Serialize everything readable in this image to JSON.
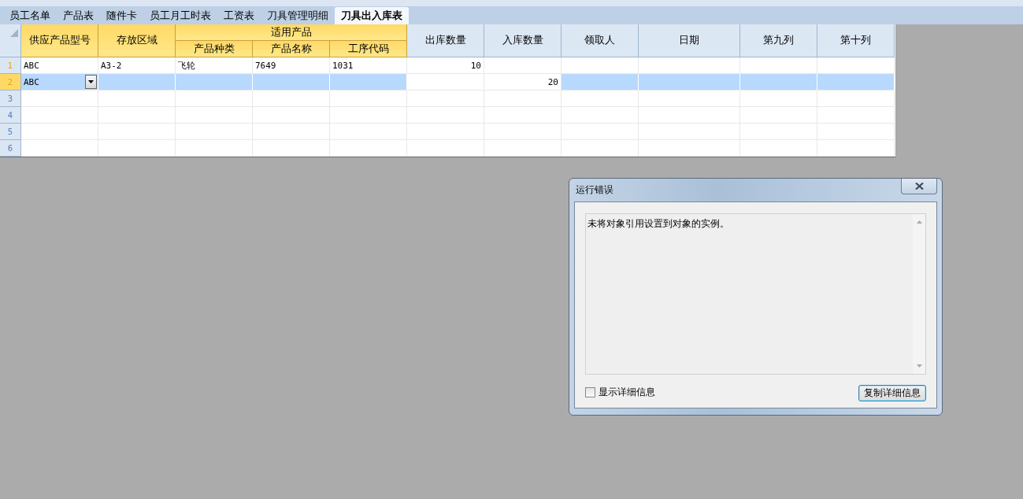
{
  "tabs": [
    {
      "label": "员工名单",
      "selected": false
    },
    {
      "label": "产品表",
      "selected": false
    },
    {
      "label": "随件卡",
      "selected": false
    },
    {
      "label": "员工月工时表",
      "selected": false
    },
    {
      "label": "工资表",
      "selected": false
    },
    {
      "label": "刀具管理明细",
      "selected": false
    },
    {
      "label": "刀具出入库表",
      "selected": true
    }
  ],
  "table": {
    "column_groups": [
      {
        "label": "适用产品",
        "highlighted": true
      }
    ],
    "columns": [
      {
        "label": "供应产品型号",
        "highlighted": true
      },
      {
        "label": "存放区域",
        "highlighted": true
      },
      {
        "label": "产品种类",
        "highlighted": true,
        "grouped": true
      },
      {
        "label": "产品名称",
        "highlighted": true,
        "grouped": true
      },
      {
        "label": "工序代码",
        "highlighted": true,
        "grouped": true
      },
      {
        "label": "出库数量",
        "highlighted": false,
        "kind": "number"
      },
      {
        "label": "入库数量",
        "highlighted": false,
        "kind": "number"
      },
      {
        "label": "领取人",
        "highlighted": false
      },
      {
        "label": "日期",
        "highlighted": false
      },
      {
        "label": "第九列",
        "highlighted": false
      },
      {
        "label": "第十列",
        "highlighted": false
      }
    ],
    "rows": [
      {
        "number": "1",
        "selected": false,
        "modified": true,
        "cells": [
          "ABC",
          "A3-2",
          "飞轮",
          "7649",
          "1031",
          "10",
          null,
          null,
          null,
          null,
          null
        ]
      },
      {
        "number": "2",
        "selected": true,
        "modified": true,
        "cells": [
          "ABC",
          null,
          null,
          null,
          null,
          null,
          "20",
          null,
          null,
          null,
          null
        ]
      },
      {
        "number": "3",
        "selected": false,
        "modified": false,
        "cells": [
          null,
          null,
          null,
          null,
          null,
          null,
          null,
          null,
          null,
          null,
          null
        ]
      },
      {
        "number": "4",
        "selected": false,
        "modified": false,
        "cells": [
          null,
          null,
          null,
          null,
          null,
          null,
          null,
          null,
          null,
          null,
          null
        ]
      },
      {
        "number": "5",
        "selected": false,
        "modified": false,
        "cells": [
          null,
          null,
          null,
          null,
          null,
          null,
          null,
          null,
          null,
          null,
          null
        ]
      },
      {
        "number": "6",
        "selected": false,
        "modified": false,
        "cells": [
          null,
          null,
          null,
          null,
          null,
          null,
          null,
          null,
          null,
          null,
          null
        ]
      }
    ]
  },
  "dialog": {
    "title": "运行错误",
    "message": "未将对象引用设置到对象的实例。",
    "show_details": {
      "label": "显示详细信息",
      "checked": false
    },
    "button": "复制详细信息"
  }
}
